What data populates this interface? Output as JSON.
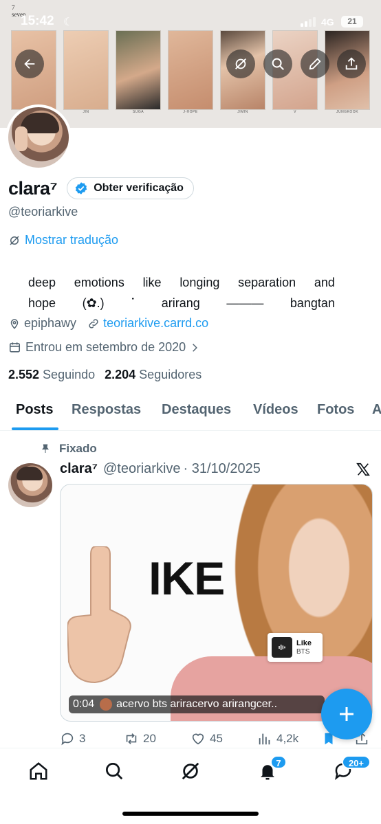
{
  "status_bar": {
    "time": "15:42",
    "network": "4G",
    "battery": "21"
  },
  "banner": {
    "seven_text": "7\nseven",
    "captions": [
      "",
      "JIN",
      "SUGA",
      "J-HOPE",
      "JIMIN",
      "V",
      "JUNGKOOK"
    ]
  },
  "profile": {
    "display_name": "clara⁷",
    "verify_button": "Obter verificação",
    "handle": "@teoriarkive",
    "translate": "Mostrar tradução",
    "bio_line1": [
      "deep",
      "emotions",
      "like",
      "longing",
      "separation",
      "and"
    ],
    "bio_line2": [
      "hope",
      "(✿.)",
      "˙",
      "arirang",
      "———",
      "bangtan"
    ],
    "location": "epiphawy",
    "website": "teoriarkive.carrd.co",
    "joined": "Entrou em setembro de 2020",
    "following_count": "2.552",
    "following_label": "Seguindo",
    "followers_count": "2.204",
    "followers_label": "Seguidores"
  },
  "tabs": [
    "Posts",
    "Respostas",
    "Destaques",
    "Vídeos",
    "Fotos",
    "A"
  ],
  "post": {
    "pinned_label": "Fixado",
    "author": "clara⁷",
    "handle": "@teoriarkive",
    "date": "· 31/10/2025",
    "media_text": "IKE",
    "like_card_title": "Like",
    "like_card_artist": "BTS",
    "duration": "0:04",
    "caption": "acervo bts ariracervo arirangcer..",
    "replies": "3",
    "reposts": "20",
    "likes": "45",
    "views": "4,2k"
  },
  "bottom_nav": {
    "notifications_badge": "7",
    "messages_badge": "20+"
  },
  "colors": {
    "accent": "#1d9bf0",
    "text": "#0f1419",
    "muted": "#536471"
  }
}
